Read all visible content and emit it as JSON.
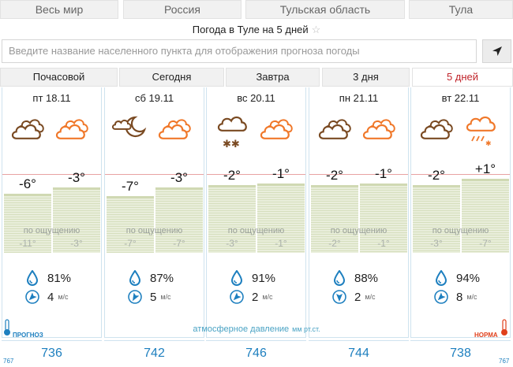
{
  "region_tabs": [
    "Весь мир",
    "Россия",
    "Тульская область",
    "Тула"
  ],
  "title": "Погода в Туле на 5 дней",
  "search": {
    "placeholder": "Введите название населенного пункта для отображения прогноза погоды"
  },
  "period_tabs": [
    "Почасовой",
    "Сегодня",
    "Завтра",
    "3 дня",
    "5 дней"
  ],
  "active_period": "5 дней",
  "feel_label": "по ощущению",
  "wind_unit": "м/с",
  "days": [
    {
      "label": "пт 18.11",
      "icons": [
        "cloudy-night-icon",
        "cloudy-day-icon"
      ],
      "temps": [
        "-6°",
        "-3°"
      ],
      "feels": [
        "-11°",
        "-3°"
      ],
      "humidity": "81%",
      "wind": "4"
    },
    {
      "label": "сб 19.11",
      "icons": [
        "partly-cloudy-night-icon",
        "cloudy-day-icon"
      ],
      "temps": [
        "-7°",
        "-3°"
      ],
      "feels": [
        "-7°",
        "-7°"
      ],
      "humidity": "87%",
      "wind": "5"
    },
    {
      "label": "вс 20.11",
      "icons": [
        "snow-night-icon",
        "cloudy-day-icon"
      ],
      "temps": [
        "-2°",
        "-1°"
      ],
      "feels": [
        "-3°",
        "-1°"
      ],
      "humidity": "91%",
      "wind": "2"
    },
    {
      "label": "пн 21.11",
      "icons": [
        "cloudy-night-icon",
        "cloudy-day-icon"
      ],
      "temps": [
        "-2°",
        "-1°"
      ],
      "feels": [
        "-2°",
        "-1°"
      ],
      "humidity": "88%",
      "wind": "2"
    },
    {
      "label": "вт 22.11",
      "icons": [
        "cloudy-night-icon",
        "sleet-day-icon"
      ],
      "temps": [
        "-2°",
        "+1°"
      ],
      "feels": [
        "-3°",
        "-7°"
      ],
      "humidity": "94%",
      "wind": "8"
    }
  ],
  "pressure": {
    "label": "атмосферное давление",
    "unit": "мм рт.ст.",
    "values": [
      "736",
      "742",
      "746",
      "744",
      "738"
    ],
    "scale_left": "767",
    "scale_right": "767",
    "legend_forecast": "ПРОГНОЗ",
    "legend_norm": "НОРМА"
  },
  "colors": {
    "accent": "#c0242b",
    "night_icon": "#7a4a22",
    "day_icon": "#f0782a",
    "pressure": "#1d7fbf",
    "bar": "#e2e8cd"
  }
}
